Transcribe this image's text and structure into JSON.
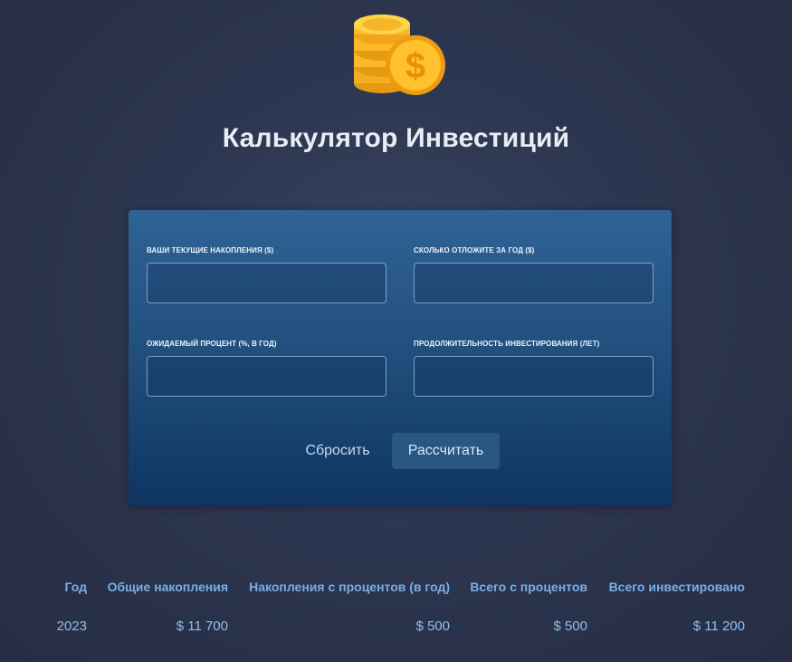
{
  "header": {
    "logo_icon": "coins-dollar-icon",
    "title": "Калькулятор Инвестиций"
  },
  "form": {
    "current_savings": {
      "label": "ВАШИ ТЕКУЩИЕ НАКОПЛЕНИЯ ($)",
      "value": ""
    },
    "yearly_savings": {
      "label": "СКОЛЬКО ОТЛОЖИТЕ ЗА ГОД ($)",
      "value": ""
    },
    "expected_return": {
      "label": "ОЖИДАЕМЫЙ ПРОЦЕНТ (%, В ГОД)",
      "value": ""
    },
    "duration": {
      "label": "ПРОДОЛЖИТЕЛЬНОСТЬ ИНВЕСТИРОВАНИЯ (ЛЕТ)",
      "value": ""
    },
    "reset_label": "Сбросить",
    "calculate_label": "Рассчитать"
  },
  "results": {
    "headers": [
      "Год",
      "Общие накопления",
      "Накопления с процентов (в год)",
      "Всего с процентов",
      "Всего инвестировано"
    ],
    "rows": [
      [
        "2023",
        "$ 11 700",
        "$ 500",
        "$ 500",
        "$ 11 200"
      ]
    ]
  },
  "colors": {
    "accent": "#79aee6",
    "card_top": "#2f6396",
    "card_bottom": "#0f3562",
    "coin": "#fbb829"
  }
}
